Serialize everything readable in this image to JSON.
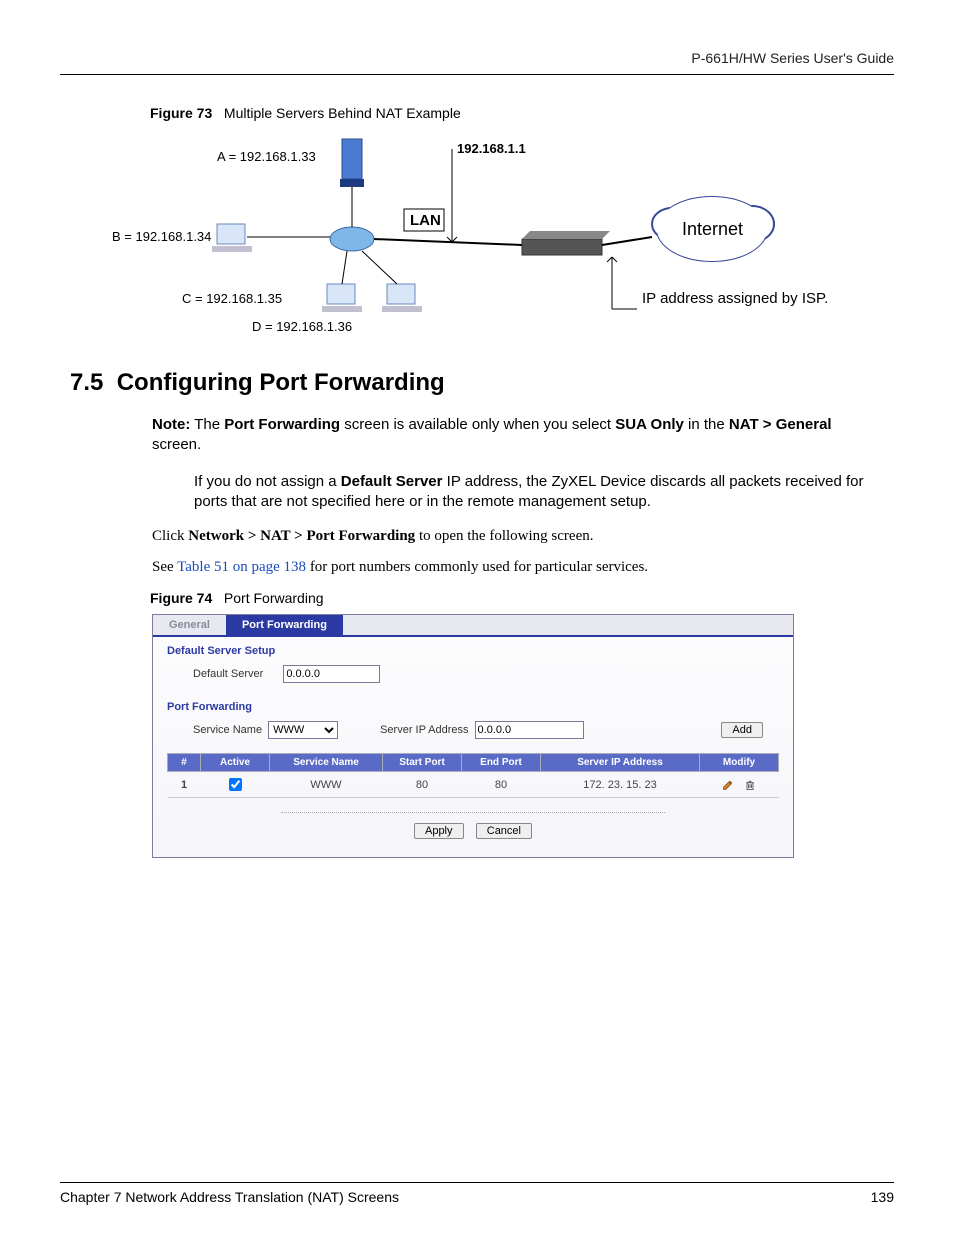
{
  "header": {
    "guide_title": "P-661H/HW Series User's Guide"
  },
  "figure73": {
    "label": "Figure 73",
    "title": "Multiple Servers Behind NAT Example",
    "nodes": {
      "A": "A = 192.168.1.33",
      "B": "B = 192.168.1.34",
      "C": "C  = 192.168.1.35",
      "D": "D = 192.168.1.36",
      "router_ip": "192.168.1.1",
      "lan": "LAN",
      "internet": "Internet",
      "isp_note": "IP address assigned by ISP."
    }
  },
  "section": {
    "number": "7.5",
    "title": "Configuring Port Forwarding"
  },
  "note": {
    "prefix": "Note:",
    "p1_a": "The ",
    "p1_b": "Port Forwarding",
    "p1_c": " screen is available only when you select ",
    "p1_d": "SUA Only",
    "p1_e": " in the ",
    "p1_f": "NAT > General",
    "p1_g": " screen.",
    "p2_a": "If you do not assign a ",
    "p2_b": "Default Server",
    "p2_c": " IP address, the ZyXEL Device discards all packets received for ports that are not specified here or in the remote management setup."
  },
  "body": {
    "click_a": "Click ",
    "click_b": "Network > NAT > Port Forwarding",
    "click_c": " to open the following screen.",
    "see_a": "See ",
    "see_link": "Table 51 on page 138",
    "see_b": " for port numbers commonly used for particular services."
  },
  "figure74": {
    "label": "Figure 74",
    "title": "Port Forwarding"
  },
  "screenshot": {
    "tabs": {
      "general": "General",
      "port_forwarding": "Port Forwarding"
    },
    "default_server_setup": "Default Server Setup",
    "default_server_label": "Default Server",
    "default_server_value": "0.0.0.0",
    "port_forwarding_title": "Port Forwarding",
    "service_name_label": "Service Name",
    "service_name_value": "WWW",
    "server_ip_label": "Server IP Address",
    "server_ip_value": "0.0.0.0",
    "add_button": "Add",
    "table": {
      "headers": {
        "num": "#",
        "active": "Active",
        "service": "Service Name",
        "start": "Start Port",
        "end": "End Port",
        "ip": "Server IP Address",
        "modify": "Modify"
      },
      "rows": [
        {
          "num": "1",
          "active": true,
          "service": "WWW",
          "start": "80",
          "end": "80",
          "ip": "172. 23. 15. 23"
        }
      ]
    },
    "apply": "Apply",
    "cancel": "Cancel"
  },
  "footer": {
    "chapter": "Chapter 7 Network Address Translation (NAT) Screens",
    "page": "139"
  }
}
